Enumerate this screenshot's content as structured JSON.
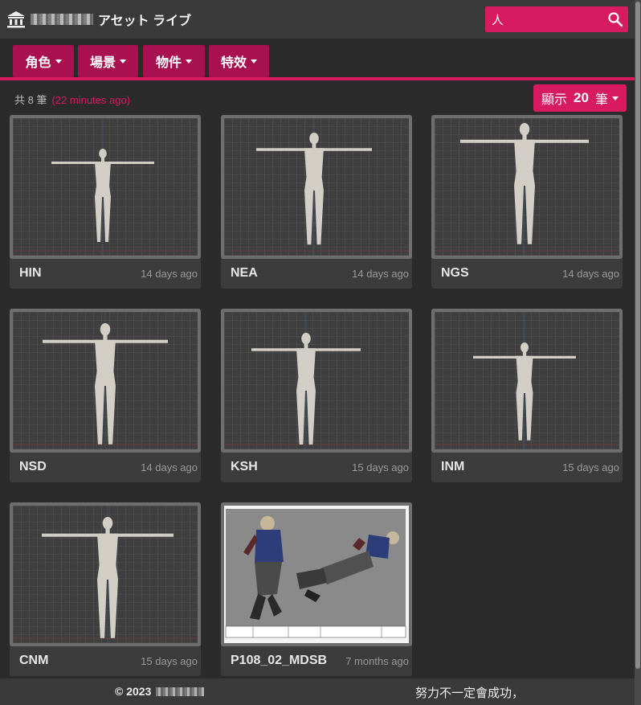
{
  "header": {
    "title": "アセット ライブ",
    "search_value": "人"
  },
  "categories": [
    {
      "label": "角色"
    },
    {
      "label": "場景"
    },
    {
      "label": "物件"
    },
    {
      "label": "特效"
    }
  ],
  "summary": {
    "total_text": "共 8 筆",
    "updated_text": "(22 minutes ago)"
  },
  "page_size": {
    "prefix": "顯示",
    "value": "20",
    "suffix": "筆"
  },
  "assets": [
    {
      "name": "HIN",
      "updated": "14 days ago",
      "thumb": "figure"
    },
    {
      "name": "NEA",
      "updated": "14 days ago",
      "thumb": "figure"
    },
    {
      "name": "NGS",
      "updated": "14 days ago",
      "thumb": "figure"
    },
    {
      "name": "NSD",
      "updated": "14 days ago",
      "thumb": "figure"
    },
    {
      "name": "KSH",
      "updated": "15 days ago",
      "thumb": "figure"
    },
    {
      "name": "INM",
      "updated": "15 days ago",
      "thumb": "figure"
    },
    {
      "name": "CNM",
      "updated": "15 days ago",
      "thumb": "figure"
    },
    {
      "name": "P108_02_MDSB",
      "updated": "7 months ago",
      "thumb": "action-sheet"
    }
  ],
  "footer": {
    "copyright": "© 2023",
    "motto": "努力不一定會成功，"
  },
  "colors": {
    "accent": "#d81b60",
    "category_button": "#a8104f",
    "header_bg": "#3a3a3a",
    "page_bg": "#2b2b2b"
  }
}
